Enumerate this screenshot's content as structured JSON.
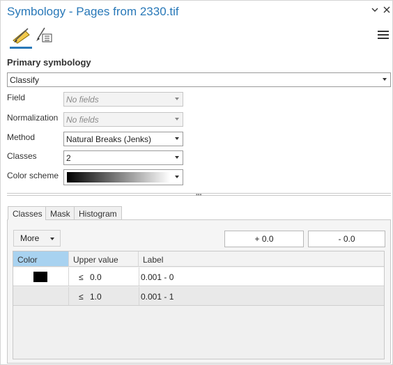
{
  "window": {
    "title": "Symbology - Pages from 2330.tif",
    "pin_icon": "chevron-down-icon",
    "close_icon": "close-icon"
  },
  "toolbar": {
    "tabs": [
      {
        "icon": "primary-symbology-icon",
        "active": true
      },
      {
        "icon": "vary-symbology-icon",
        "active": false
      }
    ],
    "menu_icon": "hamburger-menu-icon"
  },
  "primary_symbology": {
    "heading": "Primary symbology",
    "renderer": "Classify",
    "field_label": "Field",
    "field_value": "No fields",
    "normalization_label": "Normalization",
    "normalization_value": "No fields",
    "method_label": "Method",
    "method_value": "Natural Breaks (Jenks)",
    "classes_label": "Classes",
    "classes_value": "2",
    "color_scheme_label": "Color scheme",
    "color_scheme": {
      "start": "#000000",
      "end": "#ffffff"
    }
  },
  "bottom_tabs": {
    "items": [
      "Classes",
      "Mask",
      "Histogram"
    ],
    "active": "Classes"
  },
  "classes_panel": {
    "more_label": "More",
    "increase_label": "+ 0.0",
    "decrease_label": "- 0.0",
    "columns": [
      "Color",
      "Upper value",
      "Label"
    ],
    "rows": [
      {
        "color": "#000000",
        "op": "≤",
        "upper": "0.0",
        "label": "0.001 - 0"
      },
      {
        "color": "",
        "op": "≤",
        "upper": "1.0",
        "label": "0.001 - 1"
      }
    ]
  },
  "colors": {
    "accent": "#2878b8",
    "header_selected": "#a8d2f0"
  }
}
